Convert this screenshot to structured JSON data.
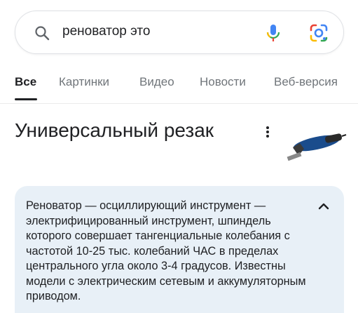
{
  "search": {
    "query": "реноватор это"
  },
  "icons": {
    "search": "search-icon",
    "mic": "mic-icon",
    "lens": "google-lens-icon",
    "more": "more-vert-icon",
    "collapse": "chevron-up-icon"
  },
  "tabs": [
    {
      "label": "Все",
      "active": true
    },
    {
      "label": "Картинки",
      "active": false
    },
    {
      "label": "Видео",
      "active": false
    },
    {
      "label": "Новости",
      "active": false
    },
    {
      "label": "Веб-версия",
      "active": false
    }
  ],
  "knowledge_panel": {
    "title": "Универсальный резак",
    "description": "Реноватор — осциллирующий инструмент — электрифицированный инструмент, шпиндель которого совершает тангенциальные колебания с частотой 10-25 тыс. колебаний ЧАС в пределах центрального угла около 3-4 градусов. Известны модели с электрическим сетевым и аккумуляторным приводом."
  },
  "colors": {
    "accent_blue": "#4285f4",
    "accent_red": "#ea4335",
    "accent_yellow": "#fbbc04",
    "accent_green": "#34a853",
    "card_background": "#e8f0f7"
  }
}
